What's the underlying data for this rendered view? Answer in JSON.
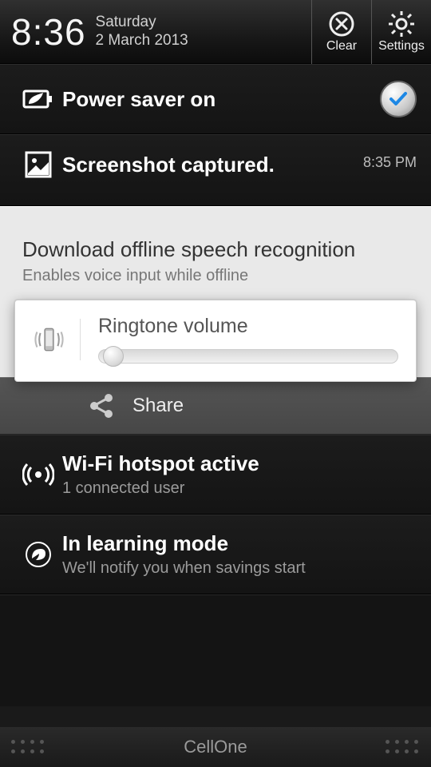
{
  "status": {
    "time": "8:36",
    "day": "Saturday",
    "date": "2 March 2013",
    "clear_label": "Clear",
    "settings_label": "Settings"
  },
  "notifications": {
    "power_saver": {
      "title": "Power saver on"
    },
    "screenshot": {
      "title": "Screenshot captured.",
      "time": "8:35 PM"
    },
    "speech": {
      "title": "Download offline speech recognition",
      "sub": "Enables voice input while offline"
    },
    "hotspot": {
      "title": "Wi-Fi hotspot active",
      "sub": "1 connected user"
    },
    "learning": {
      "title": "In learning mode",
      "sub": "We'll notify you when savings start"
    }
  },
  "volume": {
    "title": "Ringtone volume",
    "level_pct": 2
  },
  "share": {
    "label": "Share"
  },
  "footer": {
    "carrier": "CellOne"
  }
}
